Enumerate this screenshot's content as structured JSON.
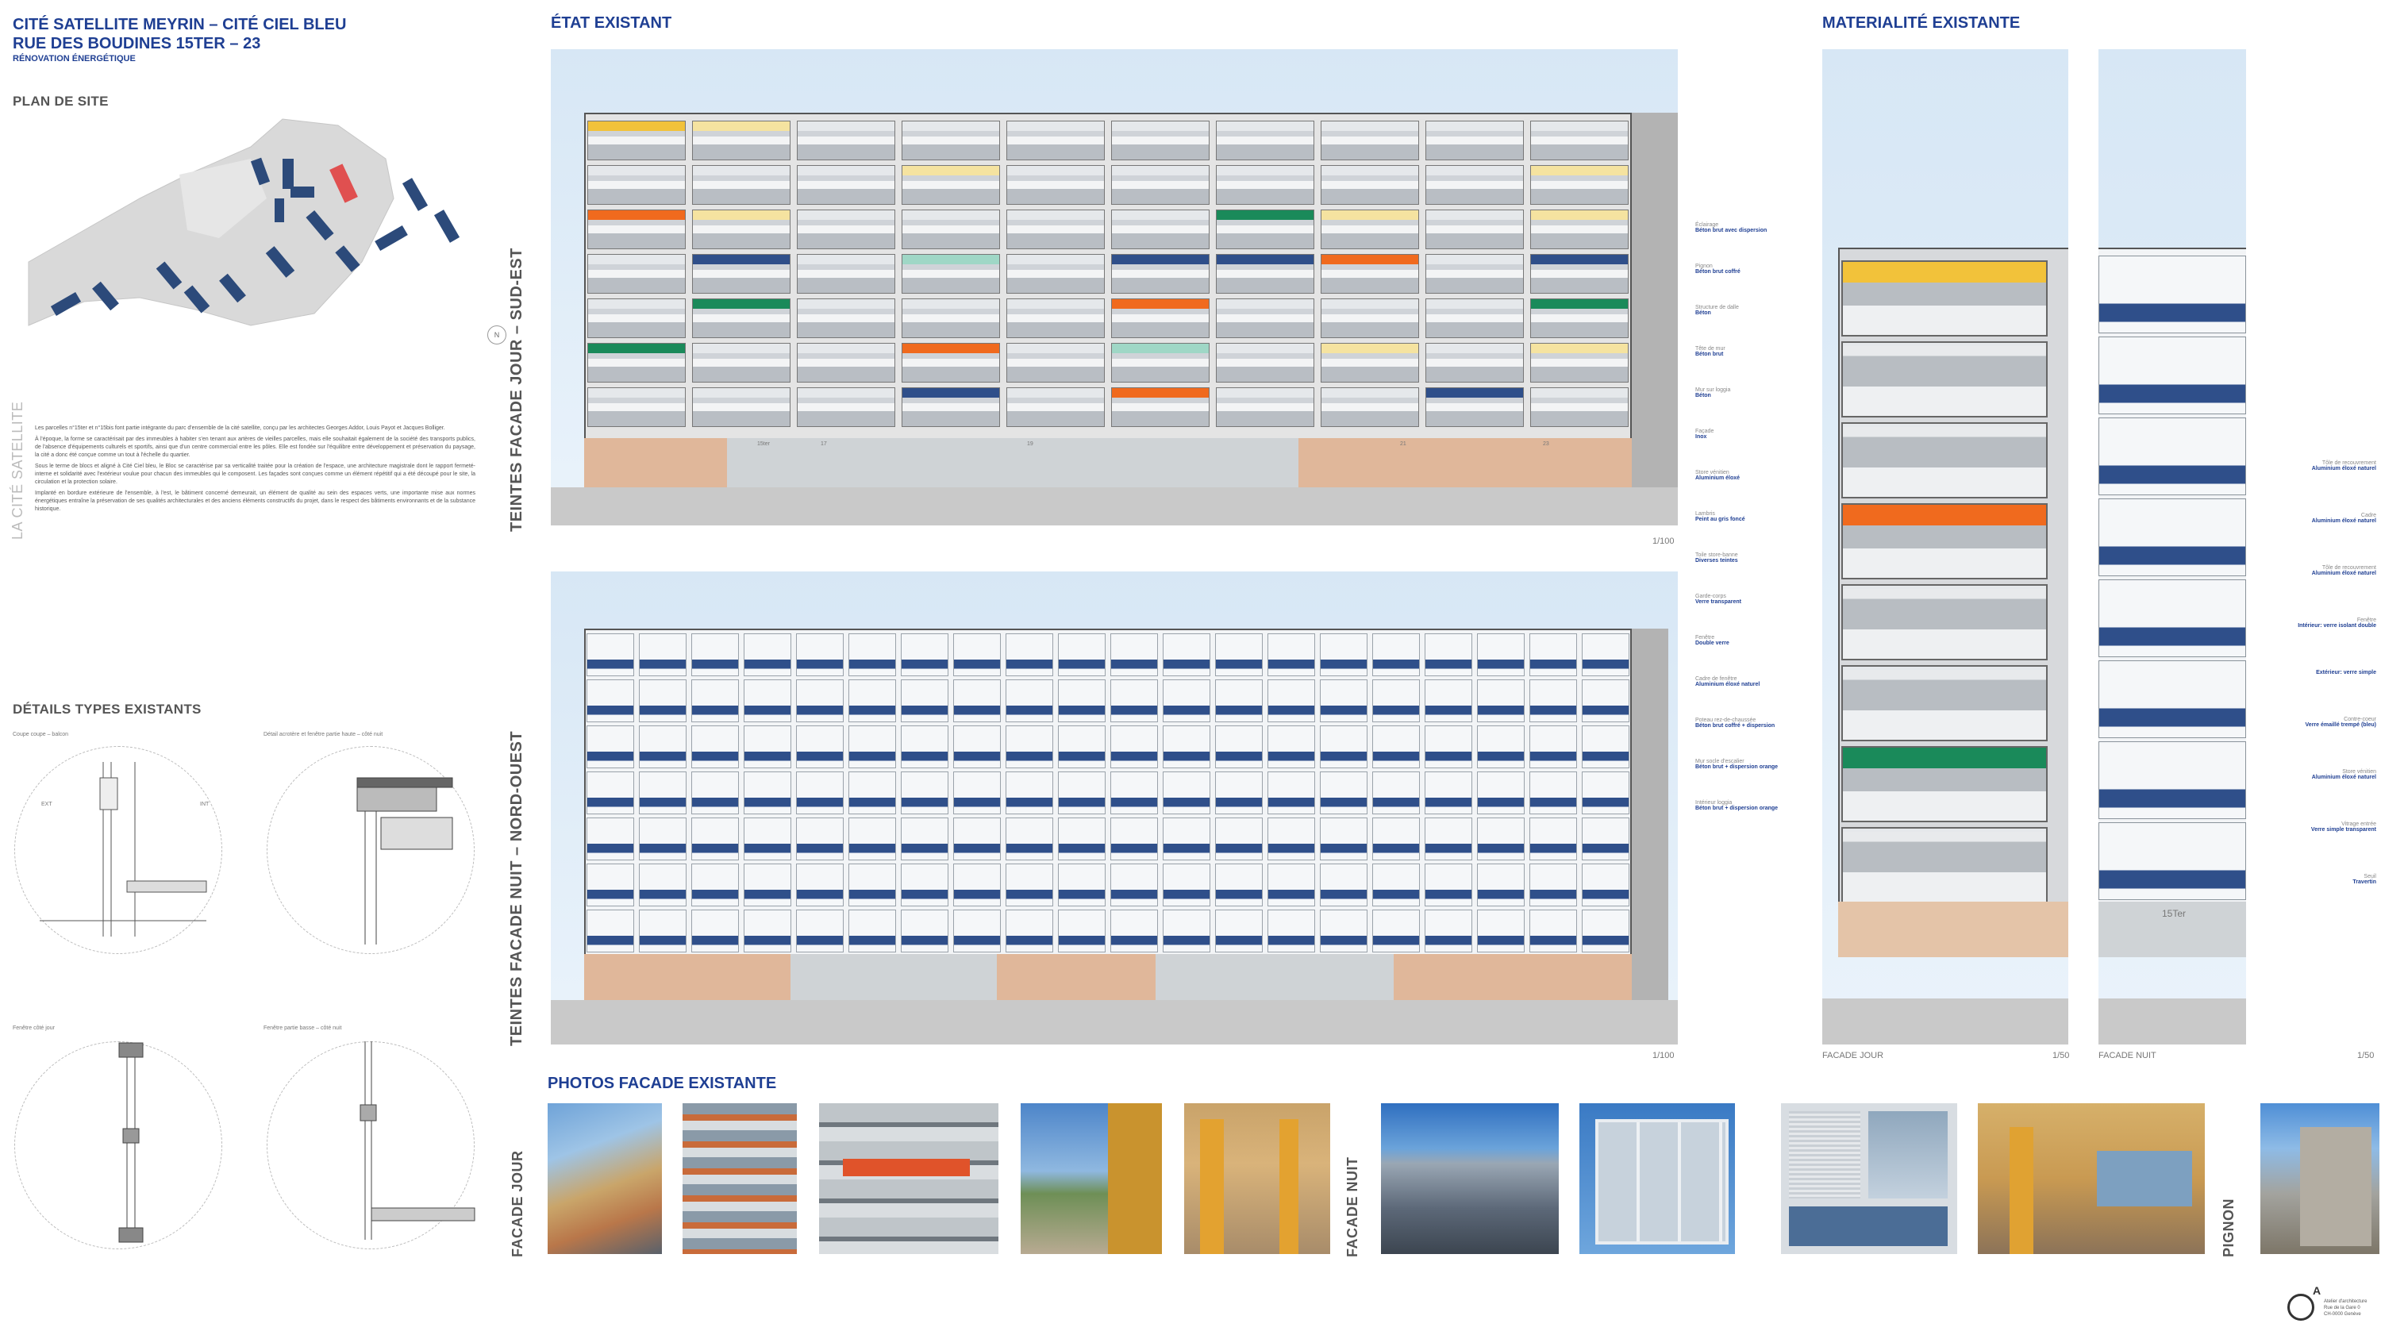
{
  "title": {
    "line1": "CITÉ SATELLITE MEYRIN – CITÉ CIEL BLEU",
    "line2": "RUE DES BOUDINES 15TER – 23",
    "sub": "RÉNOVATION ÉNERGÉTIQUE"
  },
  "sections": {
    "plan": "PLAN DE SITE",
    "details": "DÉTAILS TYPES EXISTANTS",
    "etat": "ÉTAT EXISTANT",
    "materialite": "MATERIALITÉ EXISTANTE",
    "photos": "PHOTOS FACADE EXISTANTE"
  },
  "cite_label": "LA CITÉ SATELLITE",
  "north": "N",
  "intro_paragraphs": [
    "Les parcelles n°15ter et n°15bis font partie intégrante du parc d'ensemble de la cité satellite, conçu par les architectes Georges Addor, Louis Payot et Jacques Bolliger.",
    "À l'époque, la forme se caractérisait par des immeubles à habiter s'en tenant aux artères de vieilles parcelles, mais elle souhaitait également de la société des transports publics, de l'absence d'équipements culturels et sportifs, ainsi que d'un centre commercial entre les pôles. Elle est fondée sur l'équilibre entre développement et préservation du paysage, la cité a donc été conçue comme un tout à l'échelle du quartier.",
    "Sous le terme de blocs et aligné à Cité Ciel bleu, le Bloc se caractérise par sa verticalité traitée pour la création de l'espace, une architecture magistrale dont le rapport fermeté-interne et solidarité avec l'extérieur voulue pour chacun des immeubles qui le composent. Les façades sont conçues comme un élément répétitif qui a été découpé pour le site, la circulation et la protection solaire.",
    "Implanté en bordure extérieure de l'ensemble, à l'est, le bâtiment concerné demeurait, un élément de qualité au sein des espaces verts, une importante mise aux normes énergétiques entraîne la préservation de ses qualités architecturales et des anciens éléments constructifs du projet, dans le respect des bâtiments environnants et de la substance historique."
  ],
  "detail_labels": {
    "d1": "Coupe coupe – balcon",
    "d2": "Détail acrotère et fenêtre partie haute – côté nuit",
    "d3": "Fenêtre côté jour",
    "d4": "Fenêtre partie basse – côté nuit",
    "ext": "EXT",
    "int": "INT"
  },
  "facade_labels": {
    "jour": "TEINTES FACADE JOUR – SUD-EST",
    "nuit": "TEINTES FACADE NUIT – NORD-OUEST"
  },
  "scales": {
    "s100a": "1/100",
    "s100b": "1/100",
    "s50a": "1/50",
    "s50b": "1/50"
  },
  "entrance_labels": {
    "e1": "15ter",
    "e2": "17",
    "e3": "19",
    "e4": "21",
    "e5": "23"
  },
  "legend_left": [
    {
      "t": "Éclairage",
      "v": "Béton brut avec dispersion"
    },
    {
      "t": "Pignon",
      "v": "Béton brut coffré"
    },
    {
      "t": "Structure de dalle",
      "v": "Béton"
    },
    {
      "t": "Tête de mur",
      "v": "Béton brut"
    },
    {
      "t": "Mur sur loggia",
      "v": "Béton"
    },
    {
      "t": "Façade",
      "v": "Inox"
    },
    {
      "t": "Store vénitien",
      "v": "Aluminium éloxé"
    },
    {
      "t": "Lambris",
      "v": "Peint au gris foncé"
    },
    {
      "t": "Toile store-banne",
      "v": "Diverses teintes"
    },
    {
      "t": "Garde-corps",
      "v": "Verre transparent"
    },
    {
      "t": "Fenêtre",
      "v": "Double verre"
    },
    {
      "t": "Cadre de fenêtre",
      "v": "Aluminium éloxé naturel"
    },
    {
      "t": "Poteau rez-de-chaussée",
      "v": "Béton brut coffré + dispersion"
    },
    {
      "t": "Mur socle d'escalier",
      "v": "Béton brut + dispersion orange"
    },
    {
      "t": "Intérieur loggia",
      "v": "Béton brut + dispersion orange"
    }
  ],
  "legend_right": [
    {
      "t": "Tôle de recouvrement",
      "v": "Aluminium éloxé naturel"
    },
    {
      "t": "Cadre",
      "v": "Aluminium éloxé naturel"
    },
    {
      "t": "Tôle de recouvrement",
      "v": "Aluminium éloxé naturel"
    },
    {
      "t": "Fenêtre",
      "v": "Intérieur: verre isolant double"
    },
    {
      "t": "",
      "v": "Extérieur: verre simple"
    },
    {
      "t": "Contre-coeur",
      "v": "Verre émaillé trempé (bleu)"
    },
    {
      "t": "Store vénitien",
      "v": "Aluminium éloxé naturel"
    },
    {
      "t": "Vitrage entrée",
      "v": "Verre simple transparent"
    },
    {
      "t": "Seuil",
      "v": "Travertin"
    }
  ],
  "mat_labels": {
    "jour": "FACADE JOUR",
    "nuit": "FACADE NUIT",
    "door": "15Ter"
  },
  "photo_labels": {
    "jour": "FACADE JOUR",
    "nuit": "FACADE NUIT",
    "pignon": "PIGNON"
  },
  "logo": {
    "letter": "A",
    "lines": [
      "Atelier d'architecture",
      "Rue de la Gare 0",
      "CH-0000 Genève"
    ]
  },
  "colors": {
    "accent_blue": "#1f3f93",
    "panel_blue": "#2f4f8a",
    "sky": "#dbe9f6",
    "orange": "#f06a1e",
    "yellow": "#f2c23a",
    "green": "#1a8a5a"
  }
}
